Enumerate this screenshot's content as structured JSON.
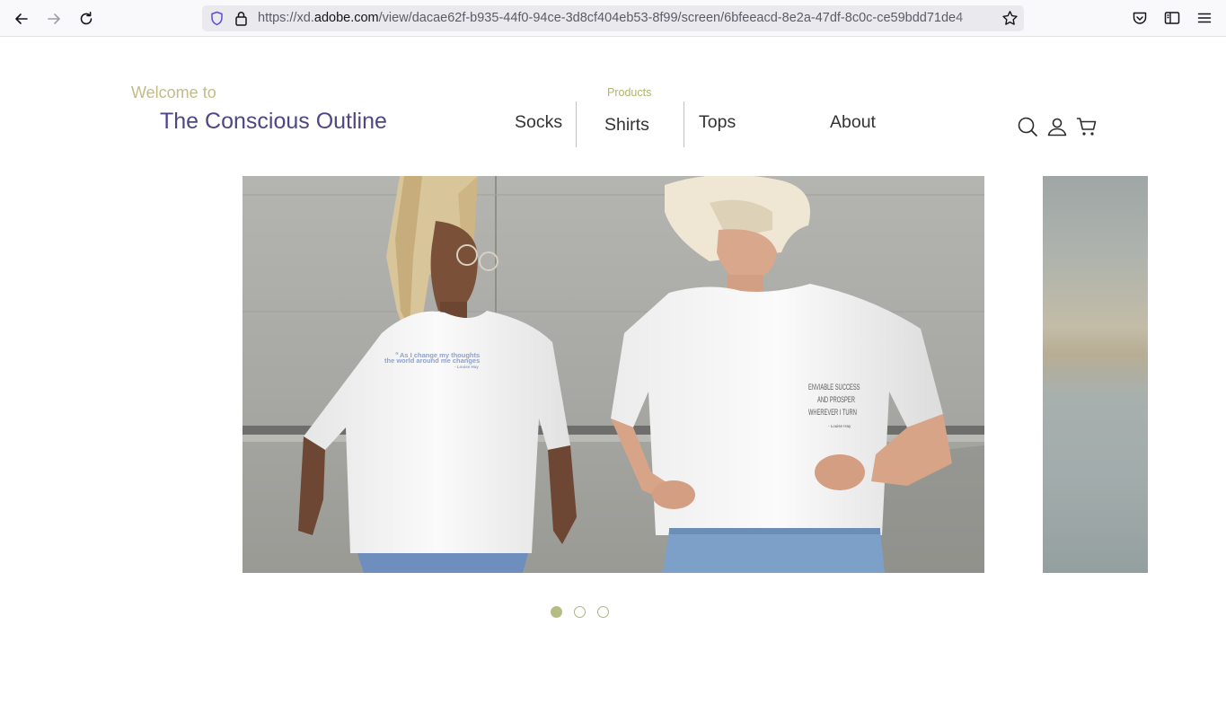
{
  "browser": {
    "url_prefix": "https://xd.",
    "url_host": "adobe.com",
    "url_path": "/view/dacae62f-b935-44f0-94ce-3d8cf404eb53-8f99/screen/6bfeeacd-8e2a-47df-8c0c-ce59bdd71de4",
    "icons": [
      "back-arrow-icon",
      "forward-arrow-icon",
      "reload-icon",
      "shield-icon",
      "lock-icon",
      "star-icon",
      "pocket-icon",
      "sidebar-icon",
      "menu-icon"
    ]
  },
  "header": {
    "welcome": "Welcome to",
    "brand": "The Conscious Outline",
    "products_label": "Products",
    "nav": {
      "socks": "Socks",
      "shirts": "Shirts",
      "tops": "Tops",
      "about": "About"
    },
    "icons": [
      "search-icon",
      "user-icon",
      "cart-icon"
    ]
  },
  "carousel": {
    "slide_text": {
      "quote_line1": "As I change my thoughts",
      "quote_line2": "the world around me changes",
      "quote_author": "- Louise Hay",
      "print2_line1": "ENVIABLE SUCCESS",
      "print2_line2": "AND PROSPER",
      "print2_line3": "WHEREVER I TURN",
      "print2_author": "- Louise Hay"
    },
    "dots": 3,
    "active_index": 0,
    "colors": {
      "active": "#b6bd84",
      "inactive_border": "#aeb57e"
    }
  },
  "colors": {
    "brand": "#4e4784",
    "welcome": "#c3bb86",
    "products_label": "#b0b56c",
    "nav_text": "#333333"
  }
}
